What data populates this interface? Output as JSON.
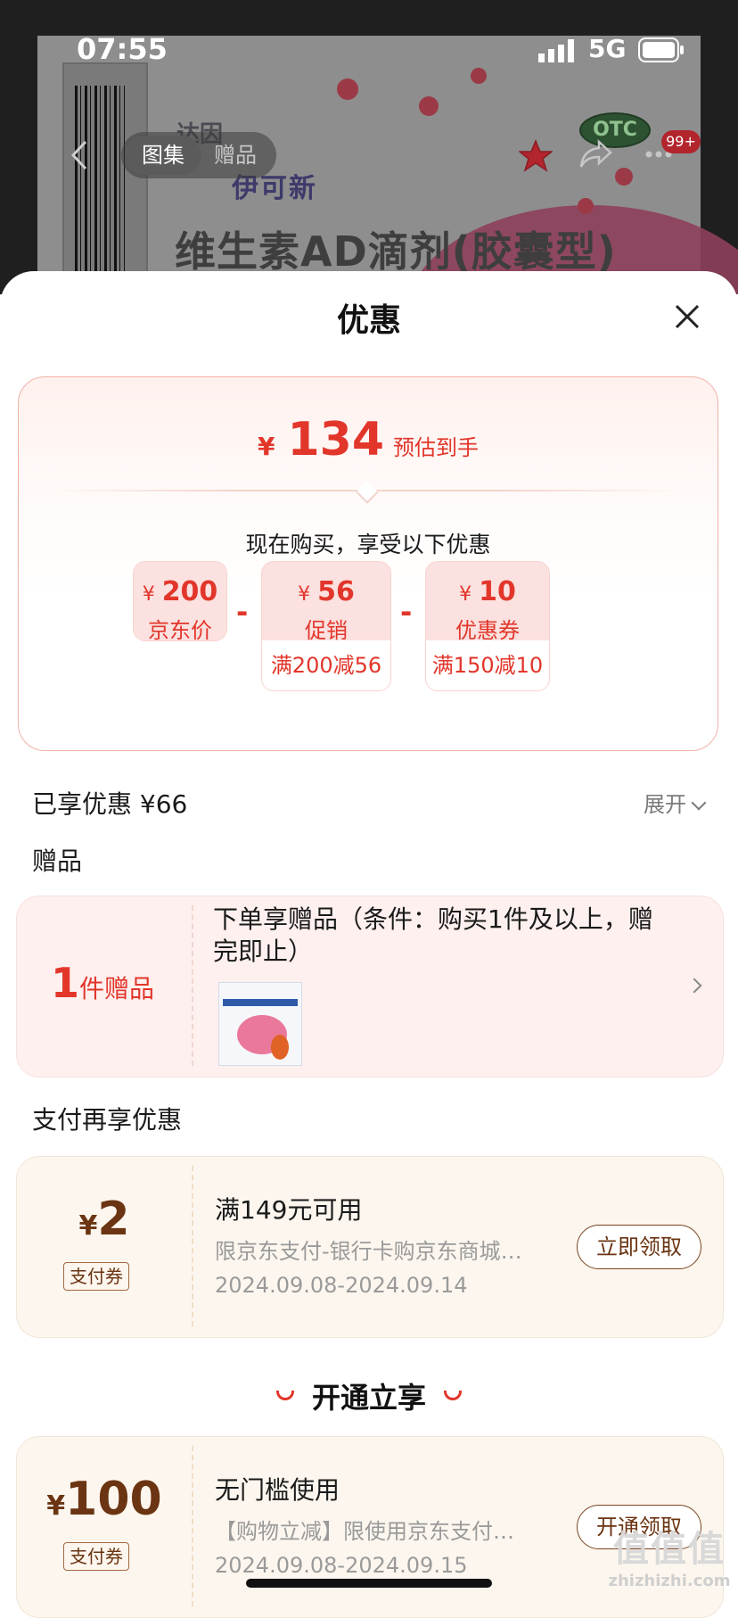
{
  "status_bar": {
    "time": "07:55",
    "network": "5G"
  },
  "product_backdrop": {
    "nav_tabs": [
      "图集",
      "赠品"
    ],
    "brand_logo": "达因",
    "brand_name": "伊可新",
    "product_title": "维生素AD滴剂(胶囊型)",
    "otc_label": "OTC",
    "message_badge": "99+",
    "icons": [
      "back-icon",
      "star-icon",
      "share-icon",
      "more-icon"
    ],
    "colors": {
      "star": "#b3252d",
      "otc_bg": "#2d5232"
    }
  },
  "sheet": {
    "title": "优惠",
    "summary": {
      "currency": "¥",
      "estimated_price": "134",
      "estimated_label": "预估到手",
      "subtitle": "现在购买，享受以下优惠",
      "items": [
        {
          "currency": "¥",
          "value": "200",
          "name": "京东价",
          "condition": ""
        },
        {
          "currency": "¥",
          "value": "56",
          "name": "促销",
          "condition": "满200减56"
        },
        {
          "currency": "¥",
          "value": "10",
          "name": "优惠券",
          "condition": "满150减10"
        }
      ],
      "operator": "-"
    },
    "enjoyed": {
      "label": "已享优惠 ¥66",
      "expand": "展开"
    },
    "gift": {
      "heading": "赠品",
      "count": "1",
      "count_unit": "件赠品",
      "description": "下单享赠品（条件：购买1件及以上，赠完即止）"
    },
    "pay_section": {
      "heading": "支付再享优惠",
      "coupons": [
        {
          "currency": "¥",
          "value": "2",
          "badge": "支付券",
          "title": "满149元可用",
          "desc": "限京东支付-银行卡购京东商城…",
          "date": "2024.09.08-2024.09.14",
          "button": "立即领取"
        }
      ]
    },
    "open_section": {
      "heading": "开通立享",
      "coupons": [
        {
          "currency": "¥",
          "value": "100",
          "badge": "支付券",
          "title": "无门槛使用",
          "desc": "【购物立减】限使用京东支付…",
          "date": "2024.09.08-2024.09.15",
          "button": "开通领取"
        }
      ]
    },
    "close_icon": "close-icon",
    "colors": {
      "accent": "#e2362b",
      "coupon_brown": "#6b3412"
    }
  },
  "watermark": {
    "line1": "值值值",
    "line2": "zhizhizhi.com"
  }
}
